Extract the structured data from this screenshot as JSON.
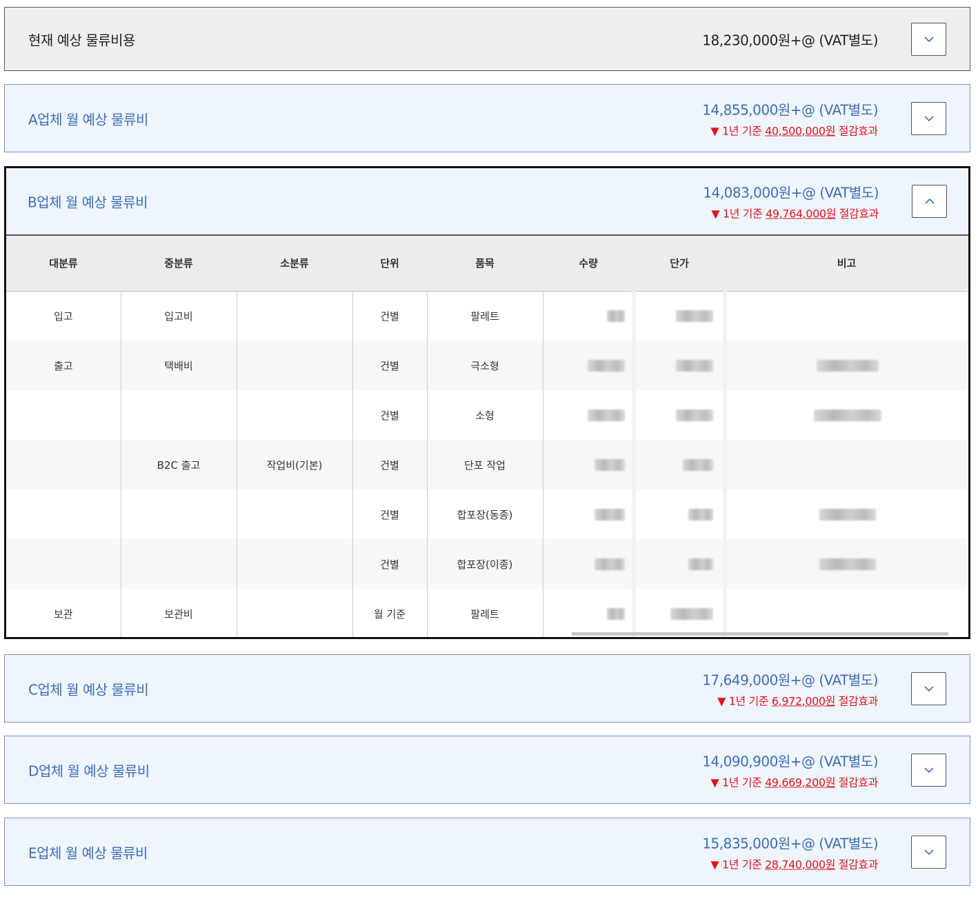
{
  "current": {
    "title": "현재 예상 물류비용",
    "price": "18,230,000원+@ (VAT별도)"
  },
  "vendors": {
    "a": {
      "title": "A업체 월 예상 물류비",
      "price": "14,855,000원+@ (VAT별도)",
      "saving_prefix": "▼ 1년 기준 ",
      "saving_amount": "40,500,000원",
      "saving_suffix": " 절감효과",
      "expanded": false
    },
    "b": {
      "title": "B업체 월 예상 물류비",
      "price": "14,083,000원+@ (VAT별도)",
      "saving_prefix": "▼ 1년 기준 ",
      "saving_amount": "49,764,000원",
      "saving_suffix": " 절감효과",
      "expanded": true
    },
    "c": {
      "title": "C업체 월 예상 물류비",
      "price": "17,649,000원+@ (VAT별도)",
      "saving_prefix": "▼ 1년 기준 ",
      "saving_amount": "6,972,000원",
      "saving_suffix": " 절감효과",
      "expanded": false
    },
    "d": {
      "title": "D업체 월 예상 물류비",
      "price": "14,090,900원+@ (VAT별도)",
      "saving_prefix": "▼ 1년 기준 ",
      "saving_amount": "49,669,200원",
      "saving_suffix": " 절감효과",
      "expanded": false
    },
    "e": {
      "title": "E업체 월 예상 물류비",
      "price": "15,835,000원+@ (VAT별도)",
      "saving_prefix": "▼ 1년 기준 ",
      "saving_amount": "28,740,000원",
      "saving_suffix": " 절감효과",
      "expanded": false
    }
  },
  "table": {
    "headers": [
      "대분류",
      "중분류",
      "소분류",
      "단위",
      "품목",
      "수량",
      "단가",
      "비고"
    ],
    "rows": [
      {
        "major": "입고",
        "middle": "입고비",
        "minor": "",
        "unit": "건별",
        "item": "팔레트"
      },
      {
        "major": "출고",
        "middle": "택배비",
        "minor": "",
        "unit": "건별",
        "item": "극소형"
      },
      {
        "major": "",
        "middle": "",
        "minor": "",
        "unit": "건별",
        "item": "소형"
      },
      {
        "major": "",
        "middle": "B2C 출고",
        "minor": "작업비(기본)",
        "unit": "건별",
        "item": "단포 작업"
      },
      {
        "major": "",
        "middle": "",
        "minor": "",
        "unit": "건별",
        "item": "합포장(동종)"
      },
      {
        "major": "",
        "middle": "",
        "minor": "",
        "unit": "건별",
        "item": "합포장(이종)"
      },
      {
        "major": "보관",
        "middle": "보관비",
        "minor": "",
        "unit": "월 기준",
        "item": "팔레트"
      }
    ]
  },
  "icons": {
    "collapsed": "chevron-down-icon",
    "expanded": "chevron-up-icon"
  },
  "colors": {
    "vendor_text": "#3e6db8",
    "saving": "#e0161b",
    "vendor_bg": "#eff5fd",
    "current_bg": "#efefef"
  }
}
